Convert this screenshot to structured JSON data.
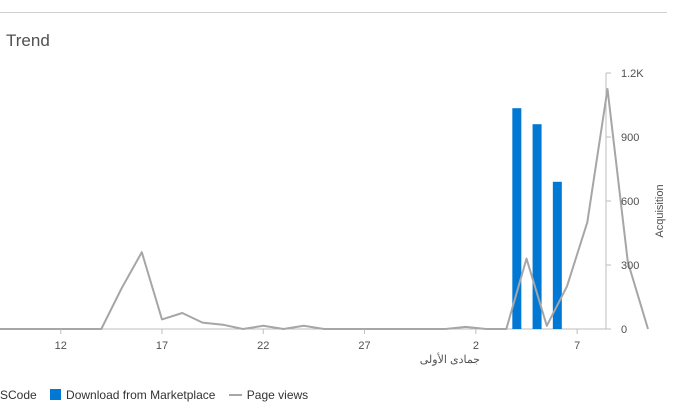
{
  "card": {
    "title": "Trend"
  },
  "legend": {
    "items": [
      {
        "label": "SCode",
        "kind": "bar"
      },
      {
        "label": "Download from Marketplace",
        "kind": "bar"
      },
      {
        "label": "Page views",
        "kind": "line"
      }
    ]
  },
  "colors": {
    "bar": "#0078d4",
    "line": "#a6a6a6",
    "axis": "#bdbdbd",
    "text": "#505050"
  },
  "chart_data": {
    "type": "bar",
    "xlabel": "",
    "ylabel": "Acquisition",
    "ylim": [
      0,
      1200
    ],
    "y_ticks": [
      "0",
      "300",
      "600",
      "900",
      "1.2K"
    ],
    "x_ticks": [
      "12",
      "17",
      "22",
      "27",
      "2",
      "7"
    ],
    "month_label": "جمادى الأولى",
    "series": [
      {
        "name": "Download from Marketplace",
        "type": "bar",
        "points": [
          {
            "day": "4",
            "value": 1035
          },
          {
            "day": "5",
            "value": 960
          },
          {
            "day": "6",
            "value": 690
          }
        ]
      },
      {
        "name": "Page views",
        "type": "line",
        "values": [
          0,
          0,
          0,
          0,
          0,
          0,
          190,
          360,
          45,
          75,
          30,
          20,
          0,
          15,
          0,
          15,
          0,
          0,
          0,
          0,
          0,
          0,
          0,
          10,
          0,
          0,
          330,
          15,
          200,
          500,
          1125,
          315,
          0
        ]
      }
    ]
  }
}
